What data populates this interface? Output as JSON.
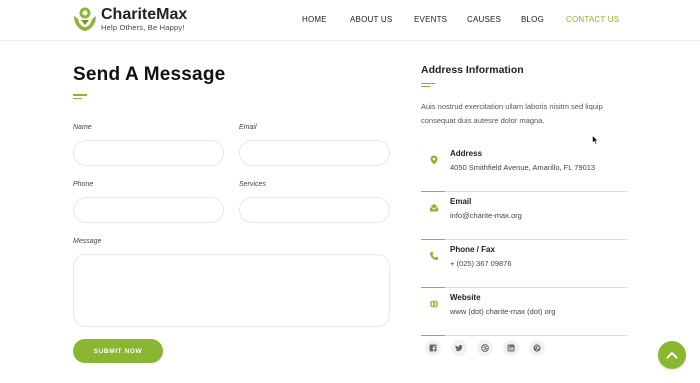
{
  "brand": {
    "name": "ChariteMax",
    "tagline": "Help Others, Be Happy!"
  },
  "nav": {
    "items": [
      "HOME",
      "ABOUT US",
      "EVENTS",
      "CAUSES",
      "BLOG",
      "CONTACT US"
    ],
    "active": "CONTACT US"
  },
  "form": {
    "title": "Send A Message",
    "name_label": "Name",
    "email_label": "Email",
    "phone_label": "Phone",
    "services_label": "Services",
    "message_label": "Message",
    "name_value": "",
    "email_value": "",
    "phone_value": "",
    "services_value": "",
    "message_value": "",
    "submit_label": "SUBMIT NOW"
  },
  "address": {
    "title": "Address Information",
    "intro": "Auis nostrud exercitation ullam laboris nisitm sed liquip consequat duis autesre dolor magna.",
    "items": [
      {
        "label": "Address",
        "value": "4050 Smithfield Avenue, Amarillo, FL 79013",
        "icon": "map-pin-icon"
      },
      {
        "label": "Email",
        "value": "info@charite-max.org",
        "icon": "envelope-icon"
      },
      {
        "label": "Phone / Fax",
        "value": "+ (025) 367 09876",
        "icon": "phone-icon"
      },
      {
        "label": "Website",
        "value": "www (dot) charite-max (dot) org",
        "icon": "globe-icon"
      }
    ]
  },
  "social": [
    "facebook-icon",
    "twitter-icon",
    "dribbble-icon",
    "linkedin-icon",
    "pinterest-icon"
  ],
  "colors": {
    "accent": "#8ab631",
    "text": "#222222",
    "border": "#e8e8e8"
  }
}
